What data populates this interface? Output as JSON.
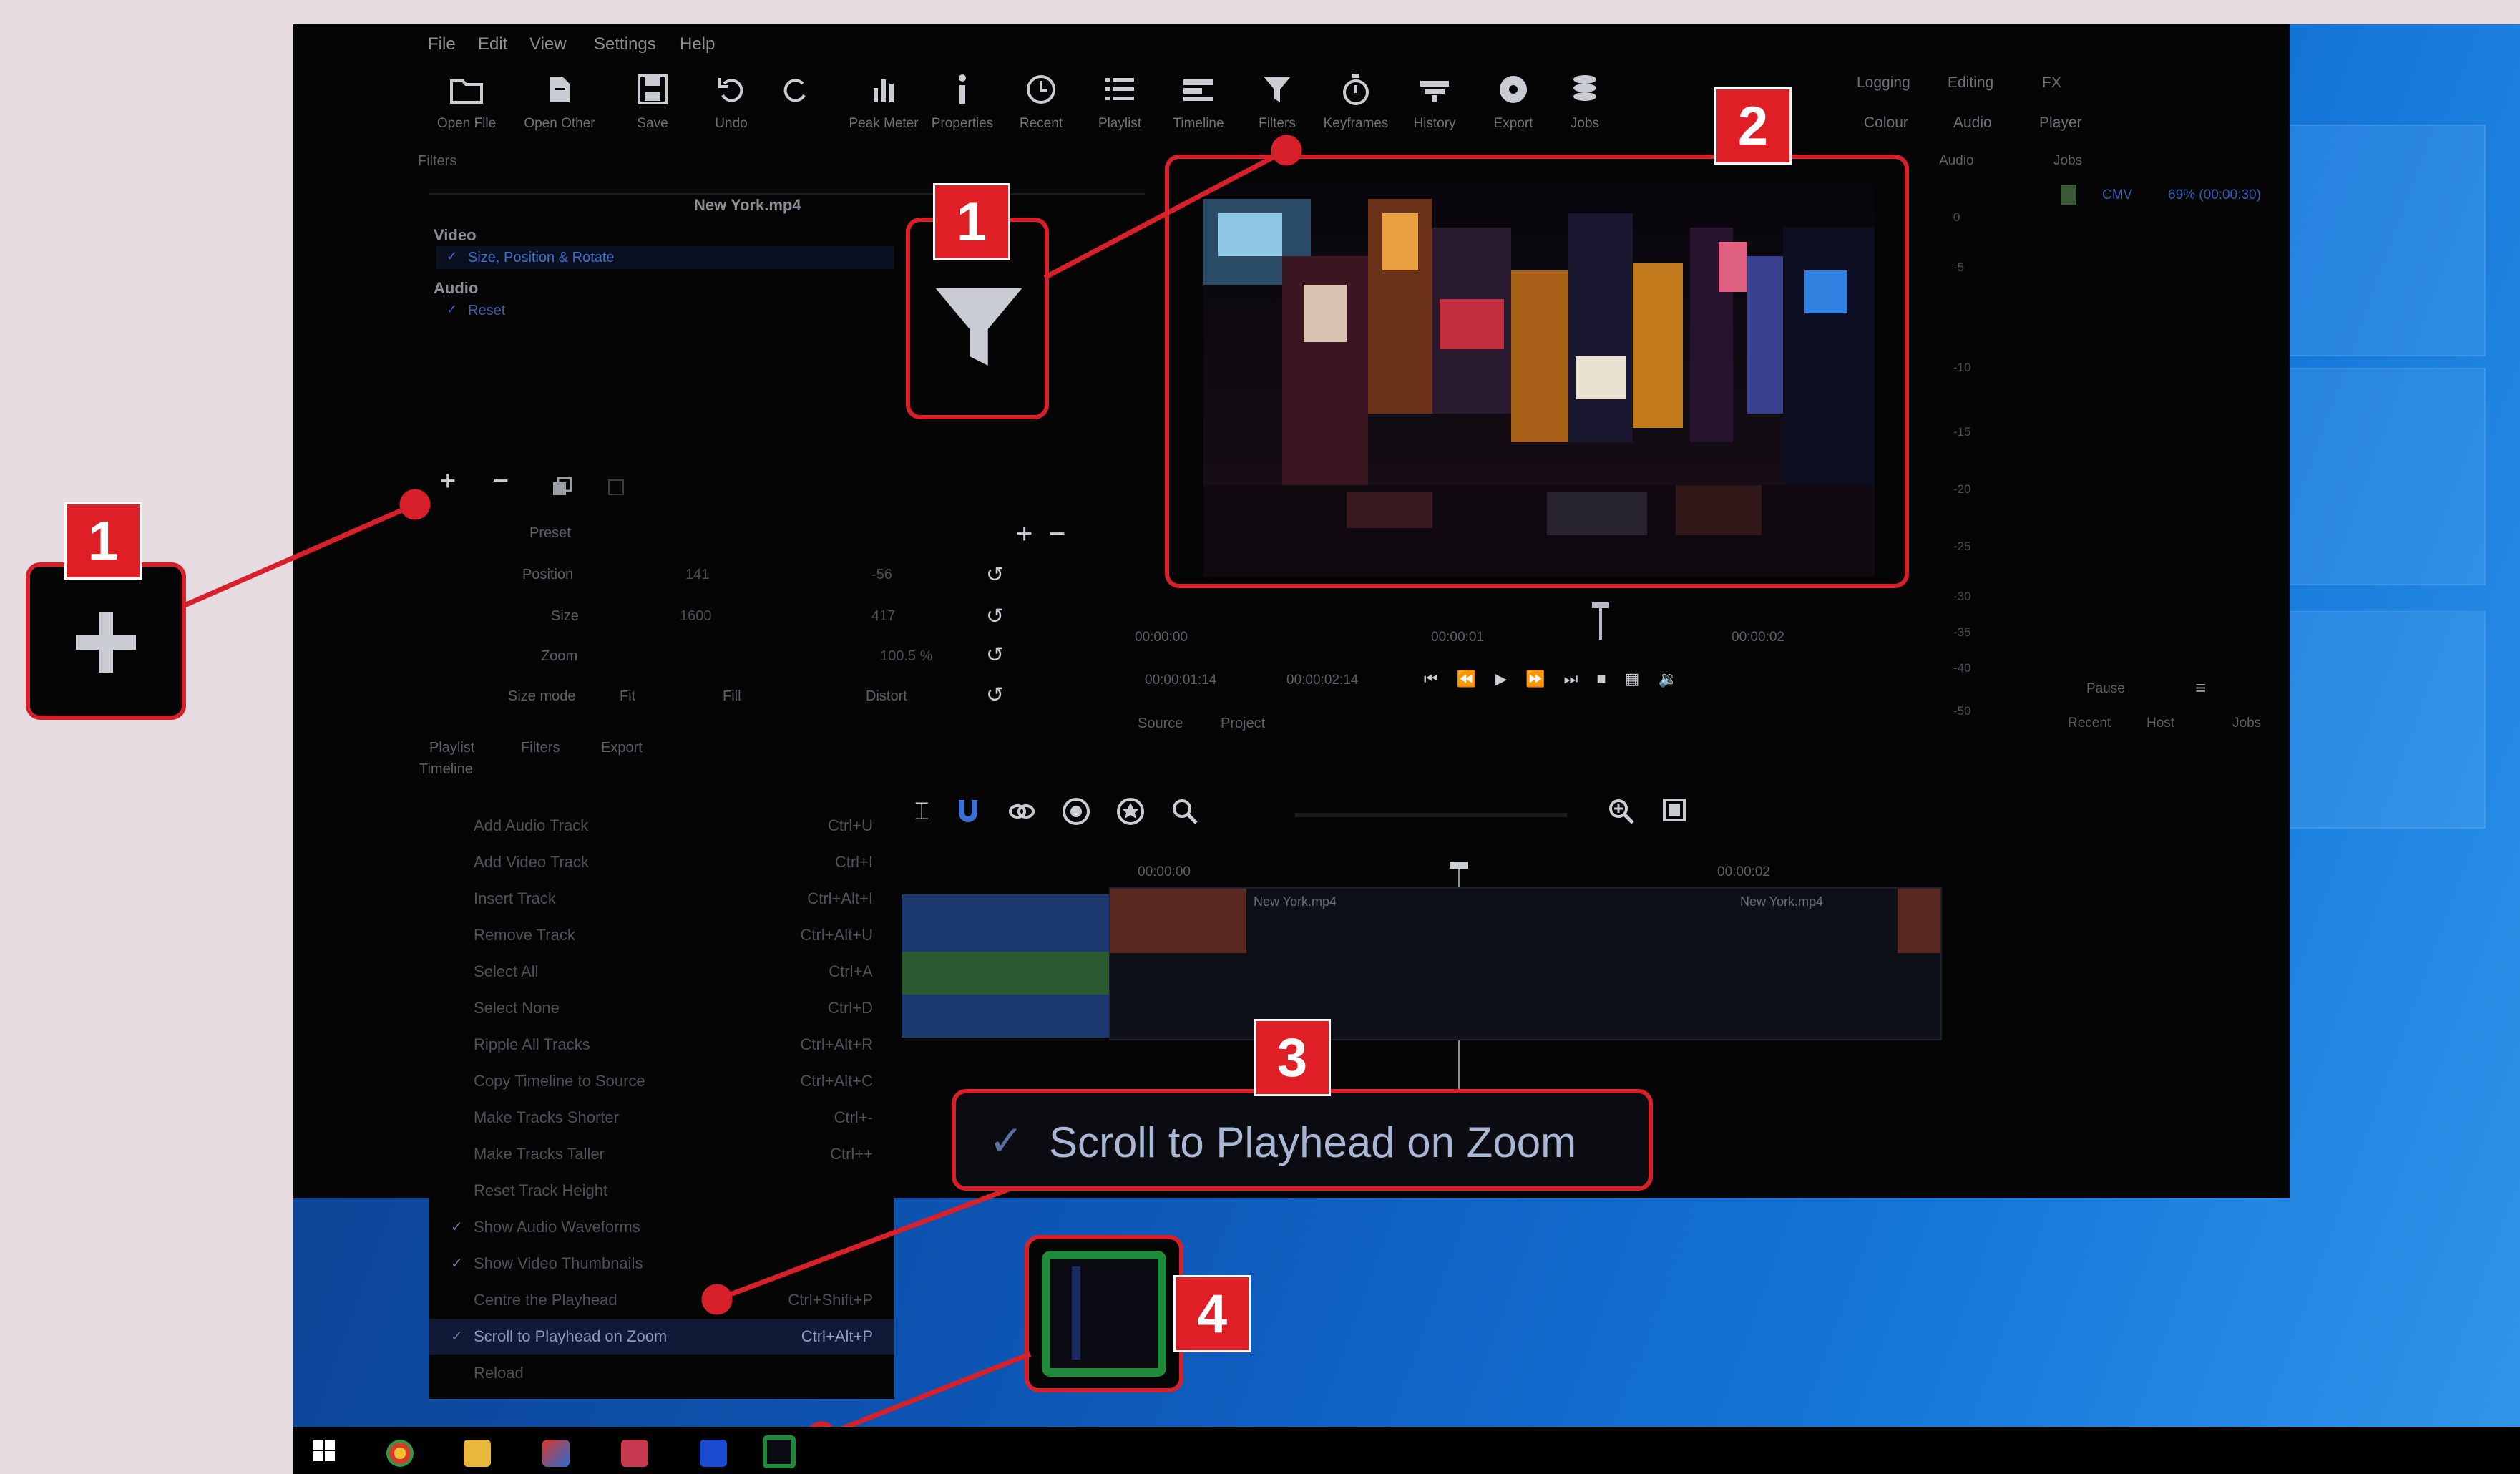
{
  "menubar": [
    "File",
    "Edit",
    "View",
    "Settings",
    "Help"
  ],
  "toolbar": {
    "items": [
      {
        "label": "Open File",
        "icon": "open-file-icon"
      },
      {
        "label": "Open Other",
        "icon": "open-other-icon"
      },
      {
        "label": "Save",
        "icon": "save-icon"
      },
      {
        "label": "Undo",
        "icon": "undo-icon"
      },
      {
        "label": "",
        "icon": "redo-icon"
      },
      {
        "label": "Peak Meter",
        "icon": "peak-meter-icon"
      },
      {
        "label": "Properties",
        "icon": "properties-icon"
      },
      {
        "label": "Recent",
        "icon": "recent-icon"
      },
      {
        "label": "Playlist",
        "icon": "playlist-icon"
      },
      {
        "label": "Timeline",
        "icon": "timeline-icon"
      },
      {
        "label": "Filters",
        "icon": "filter-icon"
      },
      {
        "label": "Keyframes",
        "icon": "keyframes-icon"
      },
      {
        "label": "History",
        "icon": "history-icon"
      },
      {
        "label": "Export",
        "icon": "export-icon"
      },
      {
        "label": "Jobs",
        "icon": "jobs-icon"
      }
    ]
  },
  "workspaces": [
    "Logging",
    "Editing",
    "FX",
    "Colour",
    "Audio",
    "Player"
  ],
  "filters_panel": {
    "title": "Filters",
    "clip": "New York.mp4",
    "video_header": "Video",
    "video_filter": "Size, Position & Rotate",
    "audio_header": "Audio",
    "audio_filter": "Reset",
    "params": [
      {
        "label": "Preset",
        "v1": "",
        "v2": ""
      },
      {
        "label": "Position",
        "v1": "141",
        "v2": "-56"
      },
      {
        "label": "Size",
        "v1": "1600",
        "v2": "417"
      },
      {
        "label": "Zoom",
        "v1": "",
        "v2": "100.5 %"
      },
      {
        "label": "Size mode",
        "v1": "Fit",
        "v2": "Distort"
      }
    ],
    "fill_label": "Fill"
  },
  "left_tabs": [
    "Playlist",
    "Filters",
    "Export"
  ],
  "player": {
    "time_start": "00:00:00",
    "time_mid": "00:00:01",
    "time_end": "00:00:02",
    "position": "00:00:01:14",
    "duration": "00:00:02:14",
    "tabs": [
      "Source",
      "Project"
    ]
  },
  "audio_panel": {
    "title": "Audio",
    "scale": [
      "0",
      "-5",
      "-10",
      "-15",
      "-20",
      "-25",
      "-30",
      "-35",
      "-40",
      "-50"
    ]
  },
  "jobs_panel": {
    "title": "Jobs",
    "job_name": "CMV",
    "job_progress": "69% (00:00:30)",
    "pause_label": "Pause",
    "tabs": [
      "Recent",
      "Host",
      "Jobs"
    ]
  },
  "timeline": {
    "title": "Timeline",
    "ruler": [
      "00:00:00",
      "00:00:02"
    ],
    "clip_label": "New York.mp4"
  },
  "context_menu": {
    "items": [
      {
        "label": "Add Audio Track",
        "shortcut": "Ctrl+U",
        "checked": false
      },
      {
        "label": "Add Video Track",
        "shortcut": "Ctrl+I",
        "checked": false
      },
      {
        "label": "Insert Track",
        "shortcut": "Ctrl+Alt+I",
        "checked": false
      },
      {
        "label": "Remove Track",
        "shortcut": "Ctrl+Alt+U",
        "checked": false
      },
      {
        "label": "Select All",
        "shortcut": "Ctrl+A",
        "checked": false
      },
      {
        "label": "Select None",
        "shortcut": "Ctrl+D",
        "checked": false
      },
      {
        "label": "Ripple All Tracks",
        "shortcut": "Ctrl+Alt+R",
        "checked": false
      },
      {
        "label": "Copy Timeline to Source",
        "shortcut": "Ctrl+Alt+C",
        "checked": false
      },
      {
        "label": "Make Tracks Shorter",
        "shortcut": "Ctrl+-",
        "checked": false
      },
      {
        "label": "Make Tracks Taller",
        "shortcut": "Ctrl++",
        "checked": false
      },
      {
        "label": "Reset Track Height",
        "shortcut": "",
        "checked": false
      },
      {
        "label": "Show Audio Waveforms",
        "shortcut": "",
        "checked": true
      },
      {
        "label": "Show Video Thumbnails",
        "shortcut": "",
        "checked": true
      },
      {
        "label": "Centre the Playhead",
        "shortcut": "Ctrl+Shift+P",
        "checked": false
      },
      {
        "label": "Scroll to Playhead on Zoom",
        "shortcut": "Ctrl+Alt+P",
        "checked": true,
        "selected": true
      },
      {
        "label": "Reload",
        "shortcut": "",
        "checked": false
      }
    ]
  },
  "callouts": {
    "one": "1",
    "two": "2",
    "three": "3",
    "four": "4",
    "three_check": "✓",
    "three_text": "Scroll to Playhead on Zoom"
  },
  "colors": {
    "accent": "#e01e25",
    "desktop": "#0d56b6"
  }
}
